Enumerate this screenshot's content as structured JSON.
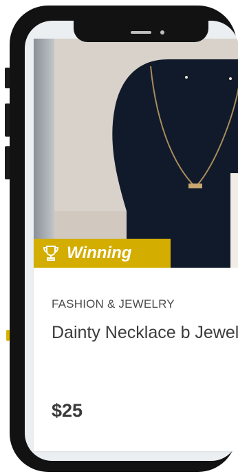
{
  "product": {
    "badge_label": "Winning",
    "badge_icon": "trophy-icon",
    "category": "FASHION & JEWELRY",
    "title": "Dainty Necklace b Jewelry",
    "price": "$25"
  },
  "colors": {
    "badge": "#d3ad00",
    "phone_frame": "#121212",
    "screen_bg": "#eceff2",
    "text_dark": "#3c3c3c"
  }
}
